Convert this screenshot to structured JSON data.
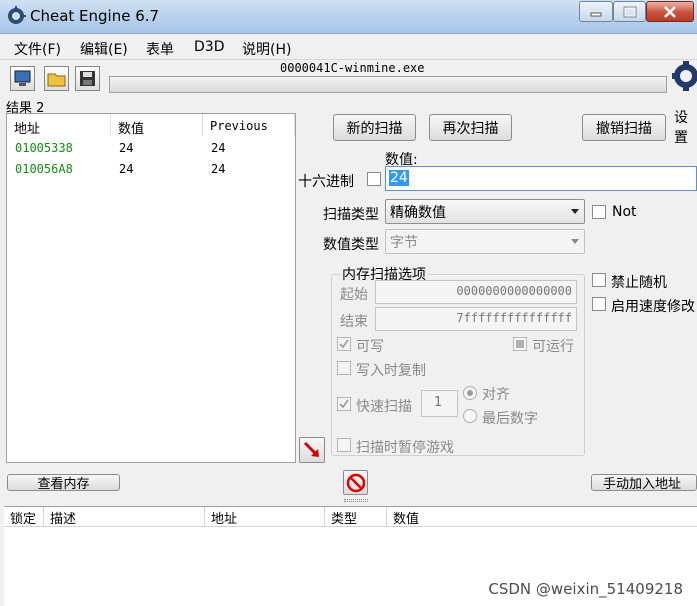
{
  "window": {
    "title": "Cheat Engine 6.7"
  },
  "menu": [
    "文件(F)",
    "编辑(E)",
    "表单",
    "D3D",
    "说明(H)"
  ],
  "toolbar": {
    "process_name": "0000041C-winmine.exe",
    "settings_label": "设置"
  },
  "results": {
    "label": "结果 2",
    "columns": [
      "地址",
      "数值",
      "Previous"
    ],
    "rows": [
      {
        "address": "01005338",
        "value": "24",
        "previous": "24"
      },
      {
        "address": "010056A8",
        "value": "24",
        "previous": "24"
      }
    ]
  },
  "scan": {
    "new_scan": "新的扫描",
    "next_scan": "再次扫描",
    "undo_scan": "撤销扫描",
    "value_label": "数值:",
    "hex_label": "十六进制",
    "value": "24",
    "scan_type_label": "扫描类型",
    "scan_type": "精确数值",
    "not_label": "Not",
    "value_type_label": "数值类型",
    "value_type": "字节"
  },
  "memory_options": {
    "title": "内存扫描选项",
    "start_label": "起始",
    "start_value": "0000000000000000",
    "end_label": "结束",
    "end_value": "7fffffffffffffff",
    "writable": "可写",
    "executable": "可运行",
    "copy_on_write": "写入时复制",
    "fast_scan": "快速扫描",
    "fast_scan_value": "1",
    "align": "对齐",
    "last_digits": "最后数字",
    "pause_game": "扫描时暂停游戏"
  },
  "right_options": {
    "disable_random": "禁止随机",
    "enable_speedhack": "启用速度修改"
  },
  "buttons": {
    "view_memory": "查看内存",
    "add_address": "手动加入地址"
  },
  "address_table": {
    "columns": [
      "锁定",
      "描述",
      "地址",
      "类型",
      "数值"
    ]
  },
  "watermark": "CSDN @weixin_51409218",
  "colors": {
    "address_green": "#1a8a1a",
    "selection_blue": "#3399ff",
    "title_gradient": "#b9d1ec"
  }
}
